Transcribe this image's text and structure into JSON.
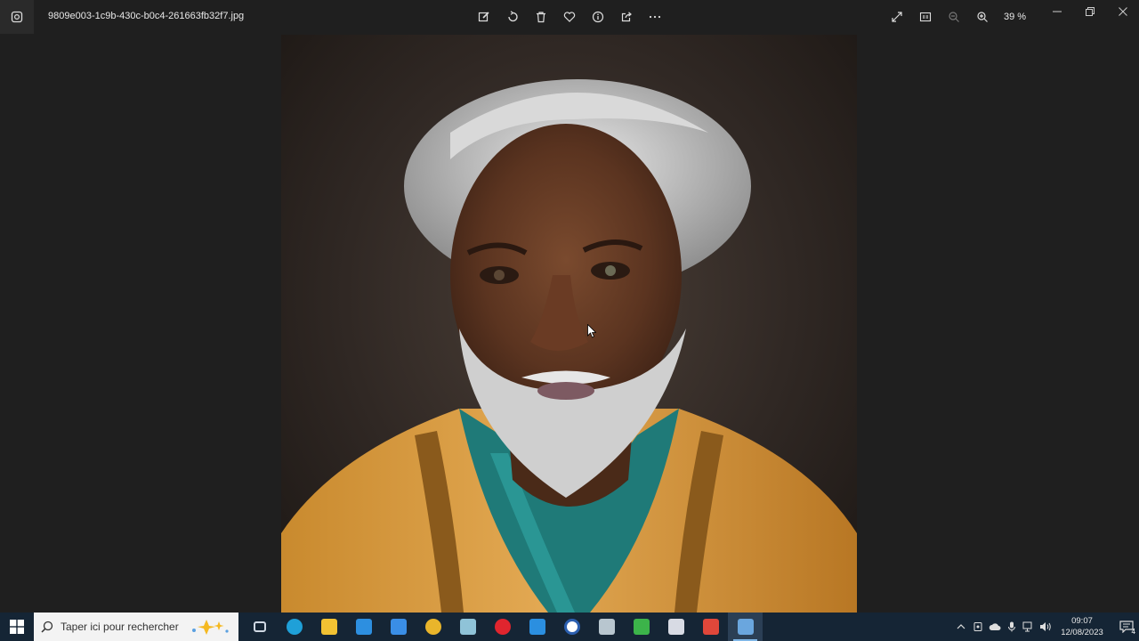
{
  "window": {
    "filename": "9809e003-1c9b-430c-b0c4-261663fb32f7.jpg",
    "zoom": "39 %"
  },
  "toolbar": {
    "center_icons": [
      "edit-icon",
      "rotate-icon",
      "delete-icon",
      "favorite-icon",
      "info-icon",
      "share-icon",
      "more-icon"
    ],
    "right_icons": [
      "fullscreen-icon",
      "actual-size-icon",
      "zoom-out-icon",
      "zoom-in-icon"
    ]
  },
  "taskbar": {
    "search_placeholder": "Taper ici pour rechercher",
    "apps": [
      {
        "name": "task-view",
        "color": "#cfd8e3"
      },
      {
        "name": "edge",
        "color": "#1fa0d8"
      },
      {
        "name": "file-explorer",
        "color": "#f2c233"
      },
      {
        "name": "store",
        "color": "#2d8fe0"
      },
      {
        "name": "mail",
        "color": "#3a8ee6"
      },
      {
        "name": "chrome",
        "color": "#e9b52b"
      },
      {
        "name": "app-tile",
        "color": "#8fc3d8"
      },
      {
        "name": "opera",
        "color": "#e0252e"
      },
      {
        "name": "vscode",
        "color": "#2b8fe0"
      },
      {
        "name": "word",
        "color": "#ffffff"
      },
      {
        "name": "app-tile-2",
        "color": "#b8c6cf"
      },
      {
        "name": "camtasia",
        "color": "#3cb44a"
      },
      {
        "name": "app-tile-3",
        "color": "#d8dbe4"
      },
      {
        "name": "app-tile-4",
        "color": "#e0473a"
      },
      {
        "name": "photos",
        "color": "#6aa6de"
      }
    ],
    "time": "09:07",
    "date": "12/08/2023",
    "notifications": "4"
  },
  "colors": {
    "background": "#1f1f1f",
    "taskbar": "#152535",
    "accent": "#7fb6e6"
  }
}
